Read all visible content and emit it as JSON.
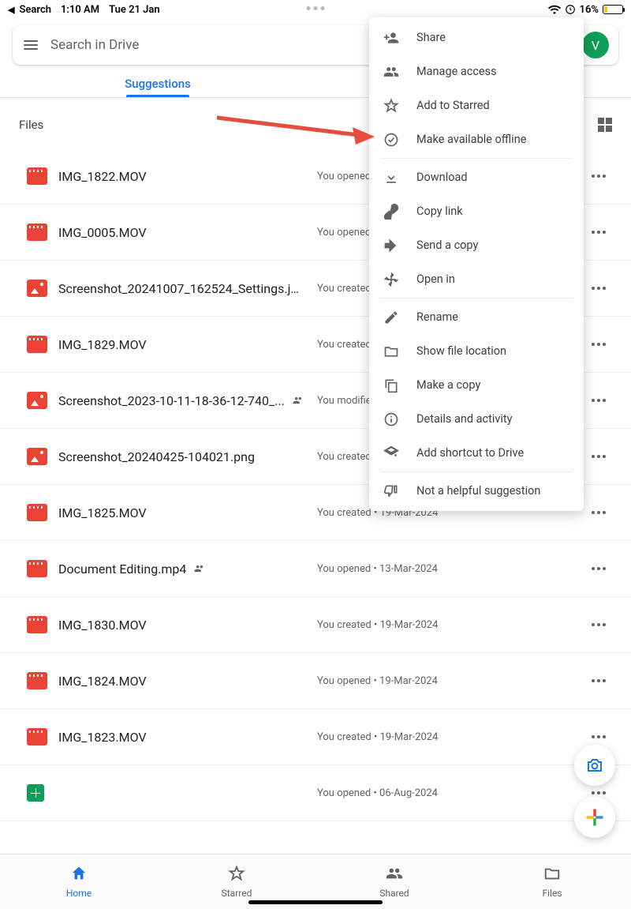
{
  "status_bar": {
    "back_app": "Search",
    "time": "1:10 AM",
    "date": "Tue 21 Jan",
    "battery_pct": "16%"
  },
  "search": {
    "placeholder": "Search in Drive"
  },
  "avatar_letter": "V",
  "tabs": {
    "active": "Suggestions"
  },
  "section_title": "Files",
  "context_menu": [
    {
      "icon": "person-add",
      "label": "Share"
    },
    {
      "icon": "group",
      "label": "Manage access"
    },
    {
      "icon": "star",
      "label": "Add to Starred"
    },
    {
      "icon": "offline",
      "label": "Make available offline",
      "highlight": true
    },
    {
      "icon": "download",
      "label": "Download"
    },
    {
      "icon": "link",
      "label": "Copy link"
    },
    {
      "icon": "send",
      "label": "Send a copy"
    },
    {
      "icon": "open",
      "label": "Open in"
    },
    {
      "icon": "pencil",
      "label": "Rename"
    },
    {
      "icon": "folder",
      "label": "Show file location"
    },
    {
      "icon": "copy",
      "label": "Make a copy"
    },
    {
      "icon": "info",
      "label": "Details and activity"
    },
    {
      "icon": "shortcut",
      "label": "Add shortcut to Drive"
    },
    {
      "icon": "thumbdown",
      "label": "Not a helpful suggestion"
    }
  ],
  "files": [
    {
      "type": "video",
      "name": "IMG_1822.MOV",
      "meta": "You opened"
    },
    {
      "type": "video",
      "name": "IMG_0005.MOV",
      "meta": "You opened"
    },
    {
      "type": "image",
      "name": "Screenshot_20241007_162524_Settings.jpg",
      "meta": "You created"
    },
    {
      "type": "video",
      "name": "IMG_1829.MOV",
      "meta": "You created"
    },
    {
      "type": "image",
      "name": "Screenshot_2023-10-11-18-36-12-740_...",
      "meta": "You modified",
      "shared": true
    },
    {
      "type": "image",
      "name": "Screenshot_20240425-104021.png",
      "meta": "You created"
    },
    {
      "type": "video",
      "name": "IMG_1825.MOV",
      "meta": "You created • 19-Mar-2024"
    },
    {
      "type": "video",
      "name": "Document Editing.mp4",
      "meta": "You opened • 13-Mar-2024",
      "shared": true
    },
    {
      "type": "video",
      "name": "IMG_1830.MOV",
      "meta": "You created • 19-Mar-2024"
    },
    {
      "type": "video",
      "name": "IMG_1824.MOV",
      "meta": "You opened • 19-Mar-2024"
    },
    {
      "type": "video",
      "name": "IMG_1823.MOV",
      "meta": "You created • 19-Mar-2024"
    },
    {
      "type": "sheet",
      "name": "",
      "meta": "You opened • 06-Aug-2024"
    }
  ],
  "bottom_nav": [
    {
      "id": "home",
      "label": "Home",
      "active": true
    },
    {
      "id": "starred",
      "label": "Starred"
    },
    {
      "id": "shared",
      "label": "Shared"
    },
    {
      "id": "files",
      "label": "Files"
    }
  ]
}
